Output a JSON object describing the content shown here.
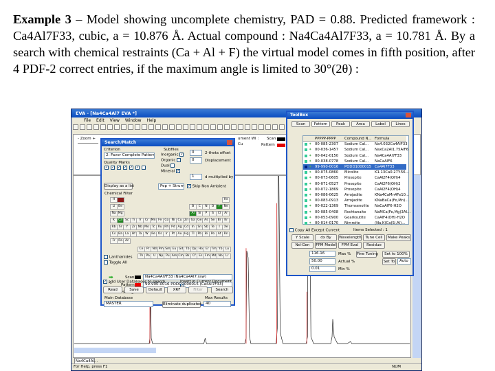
{
  "paragraph": {
    "label": "Example 3",
    "text": "– Model showing uncomplete chemistry, PAD = 0.88. Predicted framework : Ca4Al7F33, cubic, a = 10.876 Å. Actual compound : Na4Ca4Al7F33, a = 10.781 Å. By a search with chemical restraints (Ca + Al + F) the virtual model comes in fifth position, after 4 PDF-2 correct entries, if the maximum angle is limited to 30°(2θ) :"
  },
  "eva": {
    "title": "EVA - [Na4Ca4Al7 EVA *]",
    "menu": [
      "File",
      "Edit",
      "View",
      "Window",
      "Help"
    ],
    "zoom_label": "- Zoom +",
    "legend": {
      "scan": "Scan",
      "pattern": "Pattern",
      "scan_color": "#000000",
      "pattern_color": "#e00000"
    },
    "info": [
      "ument Wl :",
      "Cu"
    ],
    "tab": "Na4Ca4Al...",
    "status": "For Help, press F1",
    "num": "NUM"
  },
  "search": {
    "title": "Search/Match",
    "criterion_label": "Criterion",
    "criterion": "2: Favor Complete Patterns",
    "quality_label": "Quality Marks",
    "subfiles_label": "Subfiles",
    "subfiles": [
      {
        "label": "Inorganic",
        "checked": true
      },
      {
        "label": "Organic",
        "checked": false
      },
      {
        "label": "Dual",
        "checked": false
      },
      {
        "label": "Mineral",
        "checked": true
      }
    ],
    "two_theta_offset": "0",
    "two_theta_label": "2-theta offset",
    "displacement": "0",
    "displacement_label": "Displacement",
    "multiplied": "1",
    "multiplied_label": "d multiplied by",
    "display_list": "Display as a list",
    "peak_mode": "Pep + Strum",
    "skip_label": "Skip Non Ambient",
    "chem_filter": "Chemical Filter",
    "elements": [
      [
        "H",
        "",
        "",
        "",
        "",
        "",
        "",
        "",
        "",
        "",
        "",
        "",
        "",
        "",
        "",
        "",
        "",
        "He"
      ],
      [
        "Li",
        "Be",
        "",
        "",
        "",
        "",
        "",
        "",
        "",
        "",
        "",
        "",
        "B",
        "C",
        "N",
        "O",
        "F",
        "Ne"
      ],
      [
        "Na",
        "Mg",
        "",
        "",
        "",
        "",
        "",
        "",
        "",
        "",
        "",
        "",
        "Al",
        "Si",
        "P",
        "S",
        "Cl",
        "Ar"
      ],
      [
        "K",
        "Ca",
        "Sc",
        "Ti",
        "V",
        "Cr",
        "Mn",
        "Fe",
        "Co",
        "Ni",
        "Cu",
        "Zn",
        "Ga",
        "Ge",
        "As",
        "Se",
        "Br",
        "Kr"
      ],
      [
        "Rb",
        "Sr",
        "Y",
        "Zr",
        "Nb",
        "Mo",
        "Tc",
        "Ru",
        "Rh",
        "Pd",
        "Ag",
        "Cd",
        "In",
        "Sn",
        "Sb",
        "Te",
        "I",
        "Xe"
      ],
      [
        "Cs",
        "Ba",
        "La",
        "Hf",
        "Ta",
        "W",
        "Re",
        "Os",
        "Ir",
        "Pt",
        "Au",
        "Hg",
        "Tl",
        "Pb",
        "Bi",
        "Po",
        "At",
        "Rn"
      ],
      [
        "Fr",
        "Ra",
        "Ac"
      ]
    ],
    "lanthanides": [
      "Ce",
      "Pr",
      "Nd",
      "Pm",
      "Sm",
      "Eu",
      "Gd",
      "Tb",
      "Dy",
      "Ho",
      "Er",
      "Tm",
      "Yb",
      "Lu"
    ],
    "actinides": [
      "Th",
      "Pa",
      "U",
      "Np",
      "Pu",
      "Am",
      "Cm",
      "Bk",
      "Cf",
      "Es",
      "Fm",
      "Md",
      "No",
      "Lr"
    ],
    "lanthanides_label": "Lanthanides",
    "toggle_label": "Toggle All",
    "scan_label": "Scan",
    "scan_value": "Na4Ca4Al7F33 (Na4Ca4Al7.raw)",
    "pattern_label": "Pattern",
    "pattern_value": "99-990-0016 PODD1000015 (Ca4Al7F33)",
    "string_label": "String",
    "main_db_label": "Main Database",
    "main_db": "MASTER",
    "eliminate": "Eliminate duplicates",
    "max_results_label": "Max Results",
    "max_results": "40",
    "add_user_db": "add User Databases to search",
    "insert_doc": "Insert in Current Document",
    "buttons": [
      "Read",
      "Save",
      "Default",
      "XRF",
      "Filter",
      "Search"
    ]
  },
  "toolbox": {
    "title": "ToolBox",
    "tabs": [
      "Scan",
      "Pattern",
      "Peak",
      "Area",
      "Label",
      "Lines"
    ],
    "columns": [
      "PPPPP-PPPP",
      "Compound N...",
      "Formula"
    ],
    "rows": [
      [
        "00-085-2307",
        "Sodium Cal...",
        "Na4.032Ca4AlF33"
      ],
      [
        "00-036-1457",
        "Sodium Cal...",
        "NaxCa2Al1.75AlF6"
      ],
      [
        "00-042-0150",
        "Sodium Cal...",
        "Na4Ca4Al7F33"
      ],
      [
        "00-038-0778",
        "Sodium Cal...",
        "NaCaAlF6"
      ],
      [
        "99-990-0016",
        "PODD1000015",
        "Ca4Al7F33"
      ],
      [
        "00-075-0860",
        "Micolite",
        "K1.13Ca0.27Y.56..."
      ],
      [
        "00-073-0605",
        "Prosopite",
        "CaAl2F4(OH)4"
      ],
      [
        "00-071-0527",
        "Prosopite",
        "CaAl2F6(OH)2"
      ],
      [
        "00-072-1869",
        "Prosopite",
        "CaAl2F4(OH)4"
      ],
      [
        "00-086-0625",
        "Arrojadite",
        "KNa4CaMn4Fe10..."
      ],
      [
        "00-083-0913",
        "Arrojadite",
        "KNaBaCa(Fe,Mn)..."
      ],
      [
        "00-022-1369",
        "Thomsenolite",
        "NaCaAlF6·H2O"
      ],
      [
        "00-085-0408",
        "Rschtanaite",
        "NaMCa(Fe,Mg)3Al..."
      ],
      [
        "00-053-0900",
        "Gearksutite",
        "CaAlF4(OH)·H2O"
      ],
      [
        "00-014-0170",
        "Nimroite",
        "(Na,K)Ca(Si,Al)..."
      ]
    ],
    "selected_index": 4,
    "copy_label": "Copy All Except Current",
    "items_selected": "Items Selected : 1",
    "buttons1": [
      "Y Scale",
      "dx By",
      "Wavelength",
      "Tune Cell",
      "Make Peaks"
    ],
    "buttons2": [
      "Nd-Gen",
      "FPM Model",
      "FPM Eval",
      "Residue"
    ],
    "max_val": "116.16",
    "max_label": "Max %",
    "actual_val": "50.00",
    "actual_label": "Actual %",
    "min_val": "0.01",
    "min_label": "Min %",
    "fine_tuning": "Fine Tuning",
    "set_100": "Set to 100%",
    "set_to": "Set To",
    "auto": "Auto"
  }
}
